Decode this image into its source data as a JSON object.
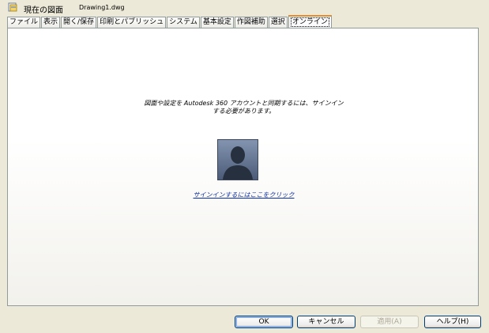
{
  "header": {
    "label": "現在の図面",
    "file": "Drawing1.dwg",
    "icon": "drawing-file-icon"
  },
  "tabs": [
    {
      "label": "ファイル",
      "active": false
    },
    {
      "label": "表示",
      "active": false
    },
    {
      "label": "開く/保存",
      "active": false
    },
    {
      "label": "印刷とパブリッシュ",
      "active": false
    },
    {
      "label": "システム",
      "active": false
    },
    {
      "label": "基本設定",
      "active": false
    },
    {
      "label": "作図補助",
      "active": false
    },
    {
      "label": "選択",
      "active": false
    },
    {
      "label": "オンライン",
      "active": true
    }
  ],
  "panel": {
    "message_line1": "図面や設定を Autodesk 360 アカウントと同期するには、サインイン",
    "message_line2": "する必要があります。",
    "avatar_icon": "user-avatar-icon",
    "signin_link": "サインインするにはここをクリック"
  },
  "buttons": {
    "ok": "OK",
    "cancel": "キャンセル",
    "apply": "適用(A)",
    "help": "ヘルプ(H)"
  },
  "colors": {
    "active_tab_accent": "#e68b2c",
    "link": "#0b2ea8",
    "avatar_bg": "#5f6f8c"
  }
}
